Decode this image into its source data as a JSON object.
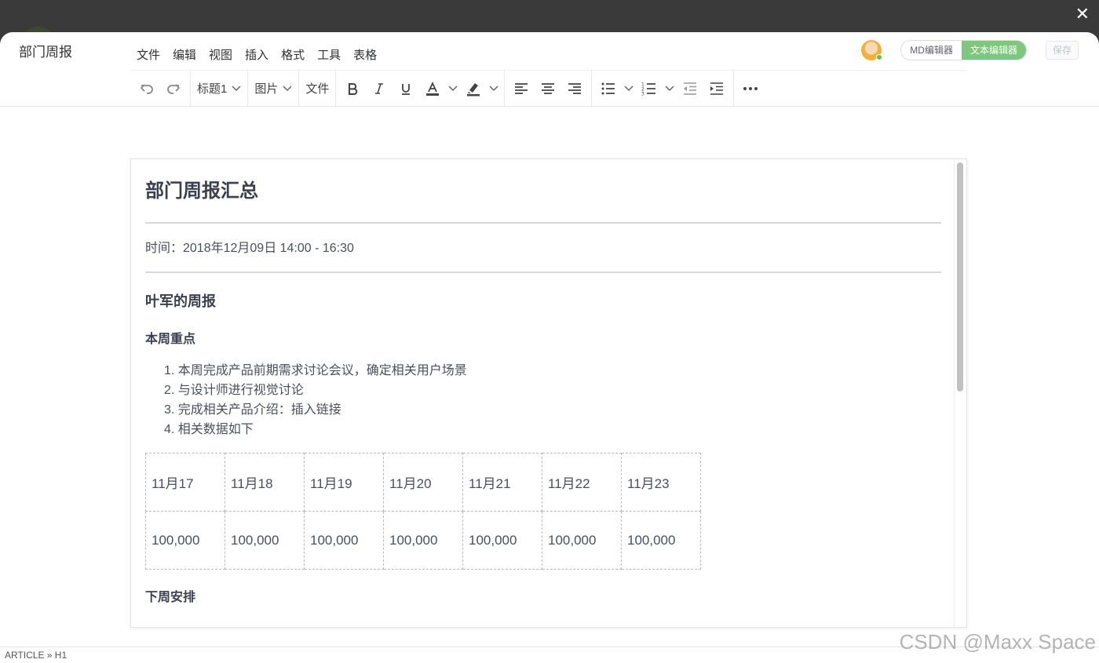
{
  "window": {
    "title": "部门周报"
  },
  "header": {
    "editor_modes": [
      "MD编辑器",
      "文本编辑器"
    ],
    "active_mode": "文本编辑器",
    "save_label": "保存"
  },
  "menubar": [
    "文件",
    "编辑",
    "视图",
    "插入",
    "格式",
    "工具",
    "表格"
  ],
  "toolbar": {
    "heading_select": "标题1",
    "image_select": "图片",
    "file_button": "文件"
  },
  "document": {
    "title": "部门周报汇总",
    "time": "时间：2018年12月09日  14:00 - 16:30",
    "section_heading": "叶军的周报",
    "focus_heading": "本周重点",
    "list": [
      "1. 本周完成产品前期需求讨论会议，确定相关用户场景",
      "2. 与设计师进行视觉讨论",
      "3. 完成相关产品介绍：插入链接",
      "4. 相关数据如下"
    ],
    "table": {
      "dates": [
        "11月17",
        "11月18",
        "11月19",
        "11月20",
        "11月21",
        "11月22",
        "11月23"
      ],
      "values": [
        "100,000",
        "100,000",
        "100,000",
        "100,000",
        "100,000",
        "100,000",
        "100,000"
      ]
    },
    "next_heading": "下周安排"
  },
  "statusbar": {
    "path": "ARTICLE » H1"
  },
  "watermark": "CSDN @Maxx Space",
  "colors": {
    "active_mode_bg": "#7ec77e",
    "text": "#303133"
  }
}
